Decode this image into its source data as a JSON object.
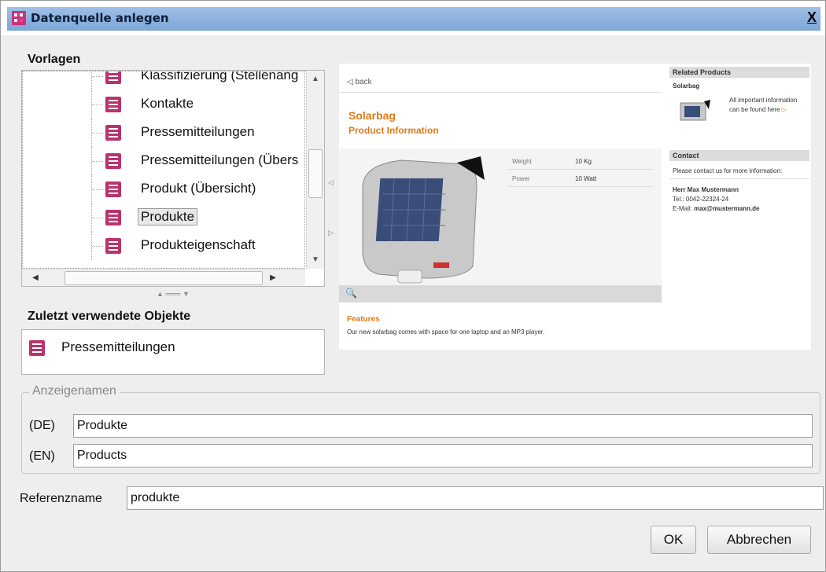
{
  "window": {
    "title": "Datenquelle anlegen",
    "close_label": "X"
  },
  "templates": {
    "label": "Vorlagen",
    "items": [
      {
        "label": "Klassifizierung (Stellenang",
        "selected": false
      },
      {
        "label": "Kontakte",
        "selected": false
      },
      {
        "label": "Pressemitteilungen",
        "selected": false
      },
      {
        "label": "Pressemitteilungen (Übers",
        "selected": false
      },
      {
        "label": "Produkt (Übersicht)",
        "selected": false
      },
      {
        "label": "Produkte",
        "selected": true
      },
      {
        "label": "Produkteigenschaft",
        "selected": false
      }
    ]
  },
  "recent": {
    "label": "Zuletzt verwendete Objekte",
    "items": [
      {
        "label": "Pressemitteilungen"
      }
    ]
  },
  "preview": {
    "back_label": "back",
    "title": "Solarbag",
    "subtitle": "Product Information",
    "specs": [
      {
        "name": "Weight",
        "value": "10 Kg"
      },
      {
        "name": "Power",
        "value": "10 Watt"
      }
    ],
    "features_title": "Features",
    "features_text": "Our new solarbag comes with space for one laptop and an MP3 player.",
    "related_title": "Related Products",
    "related_item": "Solarbag",
    "related_text1": "All important information",
    "related_text2": "can be found here",
    "contact_title": "Contact",
    "contact_text": "Please contact us for more information:",
    "contact_name": "Herr Max Mustermann",
    "contact_tel": "Tel.: 0042-22324-24",
    "contact_mail_label": "E-Mail:",
    "contact_mail": "max@mustermann.de"
  },
  "display_names": {
    "legend": "Anzeigenamen",
    "de_label": "(DE)",
    "de_value": "Produkte",
    "en_label": "(EN)",
    "en_value": "Products"
  },
  "reference": {
    "label": "Referenzname",
    "value": "produkte"
  },
  "buttons": {
    "ok": "OK",
    "cancel": "Abbrechen"
  },
  "colors": {
    "accent": "#e07a18",
    "titlebar": "#8fb3df"
  }
}
